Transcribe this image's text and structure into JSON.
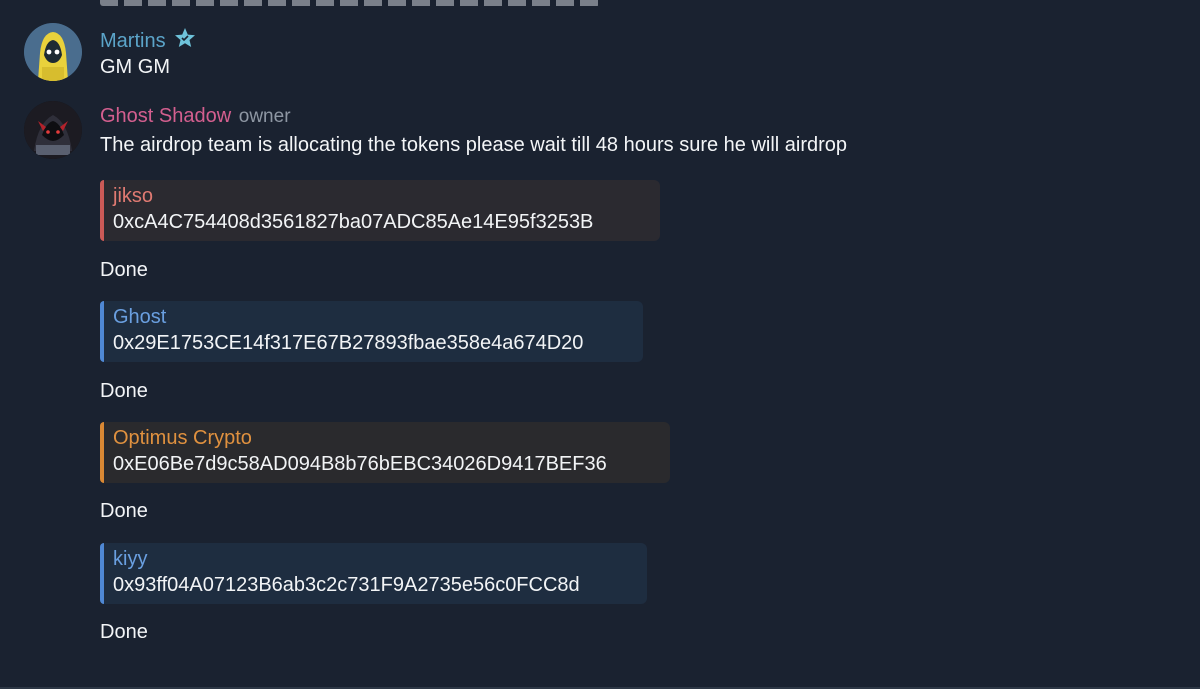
{
  "messages": [
    {
      "author": "Martins",
      "author_color": "#5ba4c9",
      "badge_icon": "star-icon",
      "text": "GM GM"
    },
    {
      "author": "Ghost Shadow",
      "author_color": "#d45f8f",
      "role": "owner",
      "text": "The airdrop team is allocating the tokens please wait till 48 hours sure he will airdrop"
    }
  ],
  "replies": [
    {
      "quote_name": "jikso",
      "quote_color": "#e07a72",
      "quote_text": "0xcA4C754408d3561827ba07ADC85Ae14E95f3253B",
      "text": "Done"
    },
    {
      "quote_name": "Ghost",
      "quote_color": "#6a9fe0",
      "quote_text": "0x29E1753CE14f317E67B27893fbae358e4a674D20",
      "text": "Done"
    },
    {
      "quote_name": "Optimus Crypto",
      "quote_color": "#e0913f",
      "quote_text": "0xE06Be7d9c58AD094B8b76bEBC34026D9417BEF36",
      "text": "Done"
    },
    {
      "quote_name": "kiyy",
      "quote_color": "#6a9fe0",
      "quote_text": "0x93ff04A07123B6ab3c2c731F9A2735e56c0FCC8d",
      "text": "Done"
    }
  ]
}
